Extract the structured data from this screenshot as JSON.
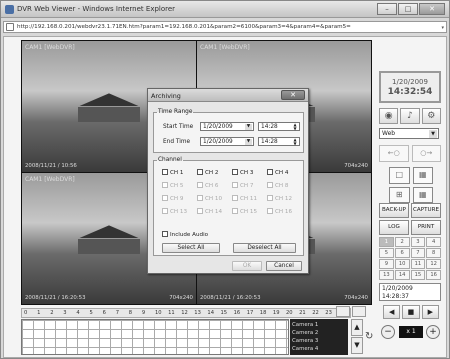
{
  "window": {
    "title": "DVR Web Viewer - Windows Internet Explorer",
    "min": "–",
    "max": "□",
    "close": "✕"
  },
  "address": {
    "url": "http://192.168.0.201/webdvr23.1.71EN.htm?param1=192.168.0.201&param2=6100&param3=4&param4=&param5=",
    "dropdown": "▾"
  },
  "cameras": [
    {
      "name": "CAM1 [WebDVR]",
      "ts": "2008/11/21 / 10:56",
      "res": "704x240"
    },
    {
      "name": "CAM1 [WebDVR]",
      "ts": "",
      "res": "704x240"
    },
    {
      "name": "CAM1 [WebDVR]",
      "ts": "2008/11/21 / 16:20:53",
      "res": "704x240"
    },
    {
      "name": "",
      "ts": "2008/11/21 / 16:20:53",
      "res": "704x240"
    }
  ],
  "timeline": {
    "hours": [
      "0",
      "1",
      "2",
      "3",
      "4",
      "5",
      "6",
      "7",
      "8",
      "9",
      "10",
      "11",
      "12",
      "13",
      "14",
      "15",
      "16",
      "17",
      "18",
      "19",
      "20",
      "21",
      "22",
      "23",
      "24"
    ]
  },
  "camlist": [
    "Camera 1",
    "Camera 2",
    "Camera 3",
    "Camera 4"
  ],
  "panel": {
    "date": "1/20/2009",
    "time": "14:32:54",
    "icons": [
      "eye-icon",
      "mic-icon",
      "gear-icon"
    ],
    "mode": "Web",
    "buttons": [
      "BACK-UP",
      "CAPTURE",
      "LOG",
      "PRINT"
    ],
    "channels": [
      "1",
      "2",
      "3",
      "4",
      "5",
      "6",
      "7",
      "8",
      "9",
      "10",
      "11",
      "12",
      "13",
      "14",
      "15",
      "16"
    ],
    "dt_date": "1/20/2009",
    "dt_time": "14:28:37",
    "speed": "x 1"
  },
  "dialog": {
    "title": "Archiving",
    "time_range": "Time Range",
    "start_label": "Start Time",
    "start_date": "1/20/2009",
    "start_time": "14:28",
    "end_label": "End Time",
    "end_date": "1/20/2009",
    "end_time": "14:28",
    "channel": "Channel",
    "channels": [
      "CH 1",
      "CH 2",
      "CH 3",
      "CH 4",
      "CH 5",
      "CH 6",
      "CH 7",
      "CH 8",
      "CH 9",
      "CH 10",
      "CH 11",
      "CH 12",
      "CH 13",
      "CH 14",
      "CH 15",
      "CH 16"
    ],
    "include_audio": "Include Audio",
    "select_all": "Select All",
    "deselect_all": "Deselect All",
    "ok": "OK",
    "cancel": "Cancel"
  }
}
